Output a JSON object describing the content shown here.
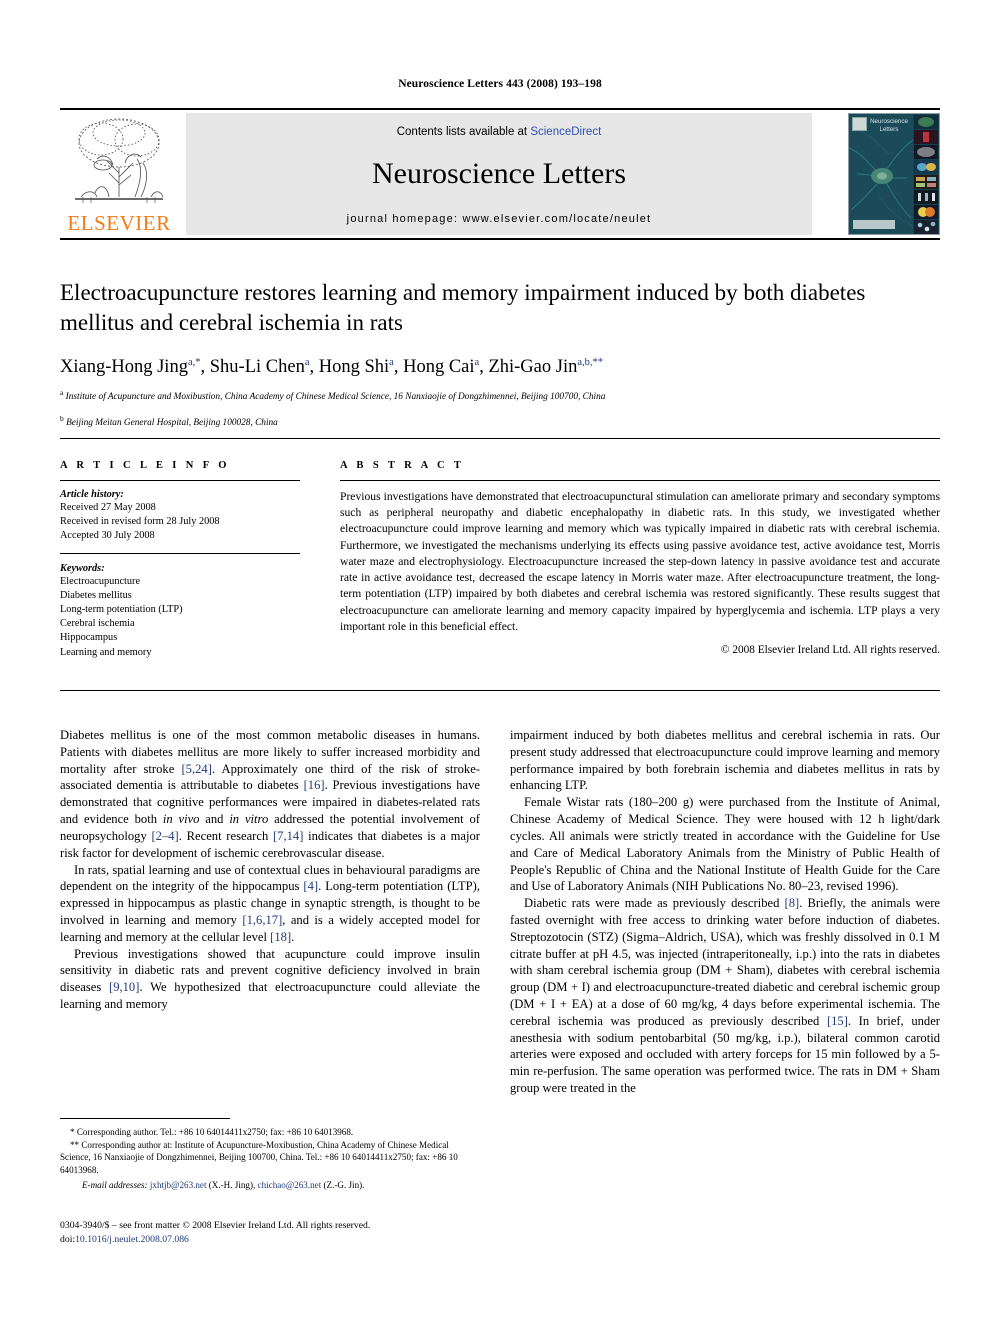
{
  "running_head": "Neuroscience Letters 443 (2008) 193–198",
  "masthead": {
    "contents_prefix": "Contents lists available at ",
    "sciencedirect": "ScienceDirect",
    "journal_title": "Neuroscience Letters",
    "homepage": "journal homepage: www.elsevier.com/locate/neulet",
    "publisher_wordmark": "ELSEVIER",
    "cover_title": "Neuroscience Letters",
    "accent_orange": "#f07c1b",
    "link_blue": "#2b50b0",
    "band_gray": "#e7e7e7"
  },
  "article": {
    "title": "Electroacupuncture restores learning and memory impairment induced by both diabetes mellitus and cerebral ischemia in rats",
    "authors_html": "Xiang-Hong Jing<sup>a,*</sup>, Shu-Li Chen<sup>a</sup>, Hong Shi<sup>a</sup>, Hong Cai<sup>a</sup>, Zhi-Gao Jin<sup>a,b,**</sup>",
    "affiliation_a": "Institute of Acupuncture and Moxibustion, China Academy of Chinese Medical Science, 16 Nanxiaojie of Dongzhimennei, Beijing 100700, China",
    "affiliation_b": "Beijing Meitan General Hospital, Beijing 100028, China"
  },
  "info": {
    "heading": "A R T I C L E  I N F O",
    "history_label": "Article history:",
    "history": [
      "Received 27 May 2008",
      "Received in revised form 28 July 2008",
      "Accepted 30 July 2008"
    ],
    "keywords_label": "Keywords:",
    "keywords": [
      "Electroacupuncture",
      "Diabetes mellitus",
      "Long-term potentiation (LTP)",
      "Cerebral ischemia",
      "Hippocampus",
      "Learning and memory"
    ]
  },
  "abstract": {
    "heading": "A B S T R A C T",
    "text": "Previous investigations have demonstrated that electroacupunctural stimulation can ameliorate primary and secondary symptoms such as peripheral neuropathy and diabetic encephalopathy in diabetic rats. In this study, we investigated whether electroacupuncture could improve learning and memory which was typically impaired in diabetic rats with cerebral ischemia. Furthermore, we investigated the mechanisms underlying its effects using passive avoidance test, active avoidance test, Morris water maze and electrophysiology. Electroacupuncture increased the step-down latency in passive avoidance test and accurate rate in active avoidance test, decreased the escape latency in Morris water maze. After electroacupuncture treatment, the long-term potentiation (LTP) impaired by both diabetes and cerebral ischemia was restored significantly. These results suggest that electroacupuncture can ameliorate learning and memory capacity impaired by hyperglycemia and ischemia. LTP plays a very important role in this beneficial effect.",
    "copyright": "© 2008 Elsevier Ireland Ltd. All rights reserved."
  },
  "body": {
    "left": [
      "Diabetes mellitus is one of the most common metabolic diseases in humans. Patients with diabetes mellitus are more likely to suffer increased morbidity and mortality after stroke [5,24]. Approximately one third of the risk of stroke-associated dementia is attributable to diabetes [16]. Previous investigations have demonstrated that cognitive performances were impaired in diabetes-related rats and evidence both in vivo and in vitro addressed the potential involvement of neuropsychology [2–4]. Recent research [7,14] indicates that diabetes is a major risk factor for development of ischemic cerebrovascular disease.",
      "In rats, spatial learning and use of contextual clues in behavioural paradigms are dependent on the integrity of the hippocampus [4]. Long-term potentiation (LTP), expressed in hippocampus as plastic change in synaptic strength, is thought to be involved in learning and memory [1,6,17], and is a widely accepted model for learning and memory at the cellular level [18].",
      "Previous investigations showed that acupuncture could improve insulin sensitivity in diabetic rats and prevent cognitive deficiency involved in brain diseases [9,10]. We hypothesized that electroacupuncture could alleviate the learning and memory"
    ],
    "right": [
      "impairment induced by both diabetes mellitus and cerebral ischemia in rats. Our present study addressed that electroacupuncture could improve learning and memory performance impaired by both forebrain ischemia and diabetes mellitus in rats by enhancing LTP.",
      "Female Wistar rats (180–200 g) were purchased from the Institute of Animal, Chinese Academy of Medical Science. They were housed with 12 h light/dark cycles. All animals were strictly treated in accordance with the Guideline for Use and Care of Medical Laboratory Animals from the Ministry of Public Health of People's Republic of China and the National Institute of Health Guide for the Care and Use of Laboratory Animals (NIH Publications No. 80–23, revised 1996).",
      "Diabetic rats were made as previously described [8]. Briefly, the animals were fasted overnight with free access to drinking water before induction of diabetes. Streptozotocin (STZ) (Sigma–Aldrich, USA), which was freshly dissolved in 0.1 M citrate buffer at pH 4.5, was injected (intraperitoneally, i.p.) into the rats in diabetes with sham cerebral ischemia group (DM + Sham), diabetes with cerebral ischemia group (DM + I) and electroacupuncture-treated diabetic and cerebral ischemic group (DM + I + EA) at a dose of 60 mg/kg, 4 days before experimental ischemia. The cerebral ischemia was produced as previously described [15]. In brief, under anesthesia with sodium pentobarbital (50 mg/kg, i.p.), bilateral common carotid arteries were exposed and occluded with artery forceps for 15 min followed by a 5-min re-perfusion. The same operation was performed twice. The rats in DM + Sham group were treated in the"
    ]
  },
  "footnotes": {
    "corresponding_1": "* Corresponding author. Tel.: +86 10 64014411x2750; fax: +86 10 64013968.",
    "corresponding_2": "** Corresponding author at: Institute of Acupuncture-Moxibustion, China Academy of Chinese Medical Science, 16 Nanxiaojie of Dongzhimennei, Beijing 100700, China. Tel.: +86 10 64014411x2750; fax: +86 10 64013968.",
    "email_label": "E-mail addresses:",
    "email_1": "jxhtjb@263.net",
    "email_1_owner": "(X.-H. Jing),",
    "email_2": "chichao@263.net",
    "email_2_owner": "(Z.-G. Jin)."
  },
  "imprint": {
    "front_matter": "0304-3940/$ – see front matter © 2008 Elsevier Ireland Ltd. All rights reserved.",
    "doi_label": "doi:",
    "doi": "10.1016/j.neulet.2008.07.086"
  }
}
